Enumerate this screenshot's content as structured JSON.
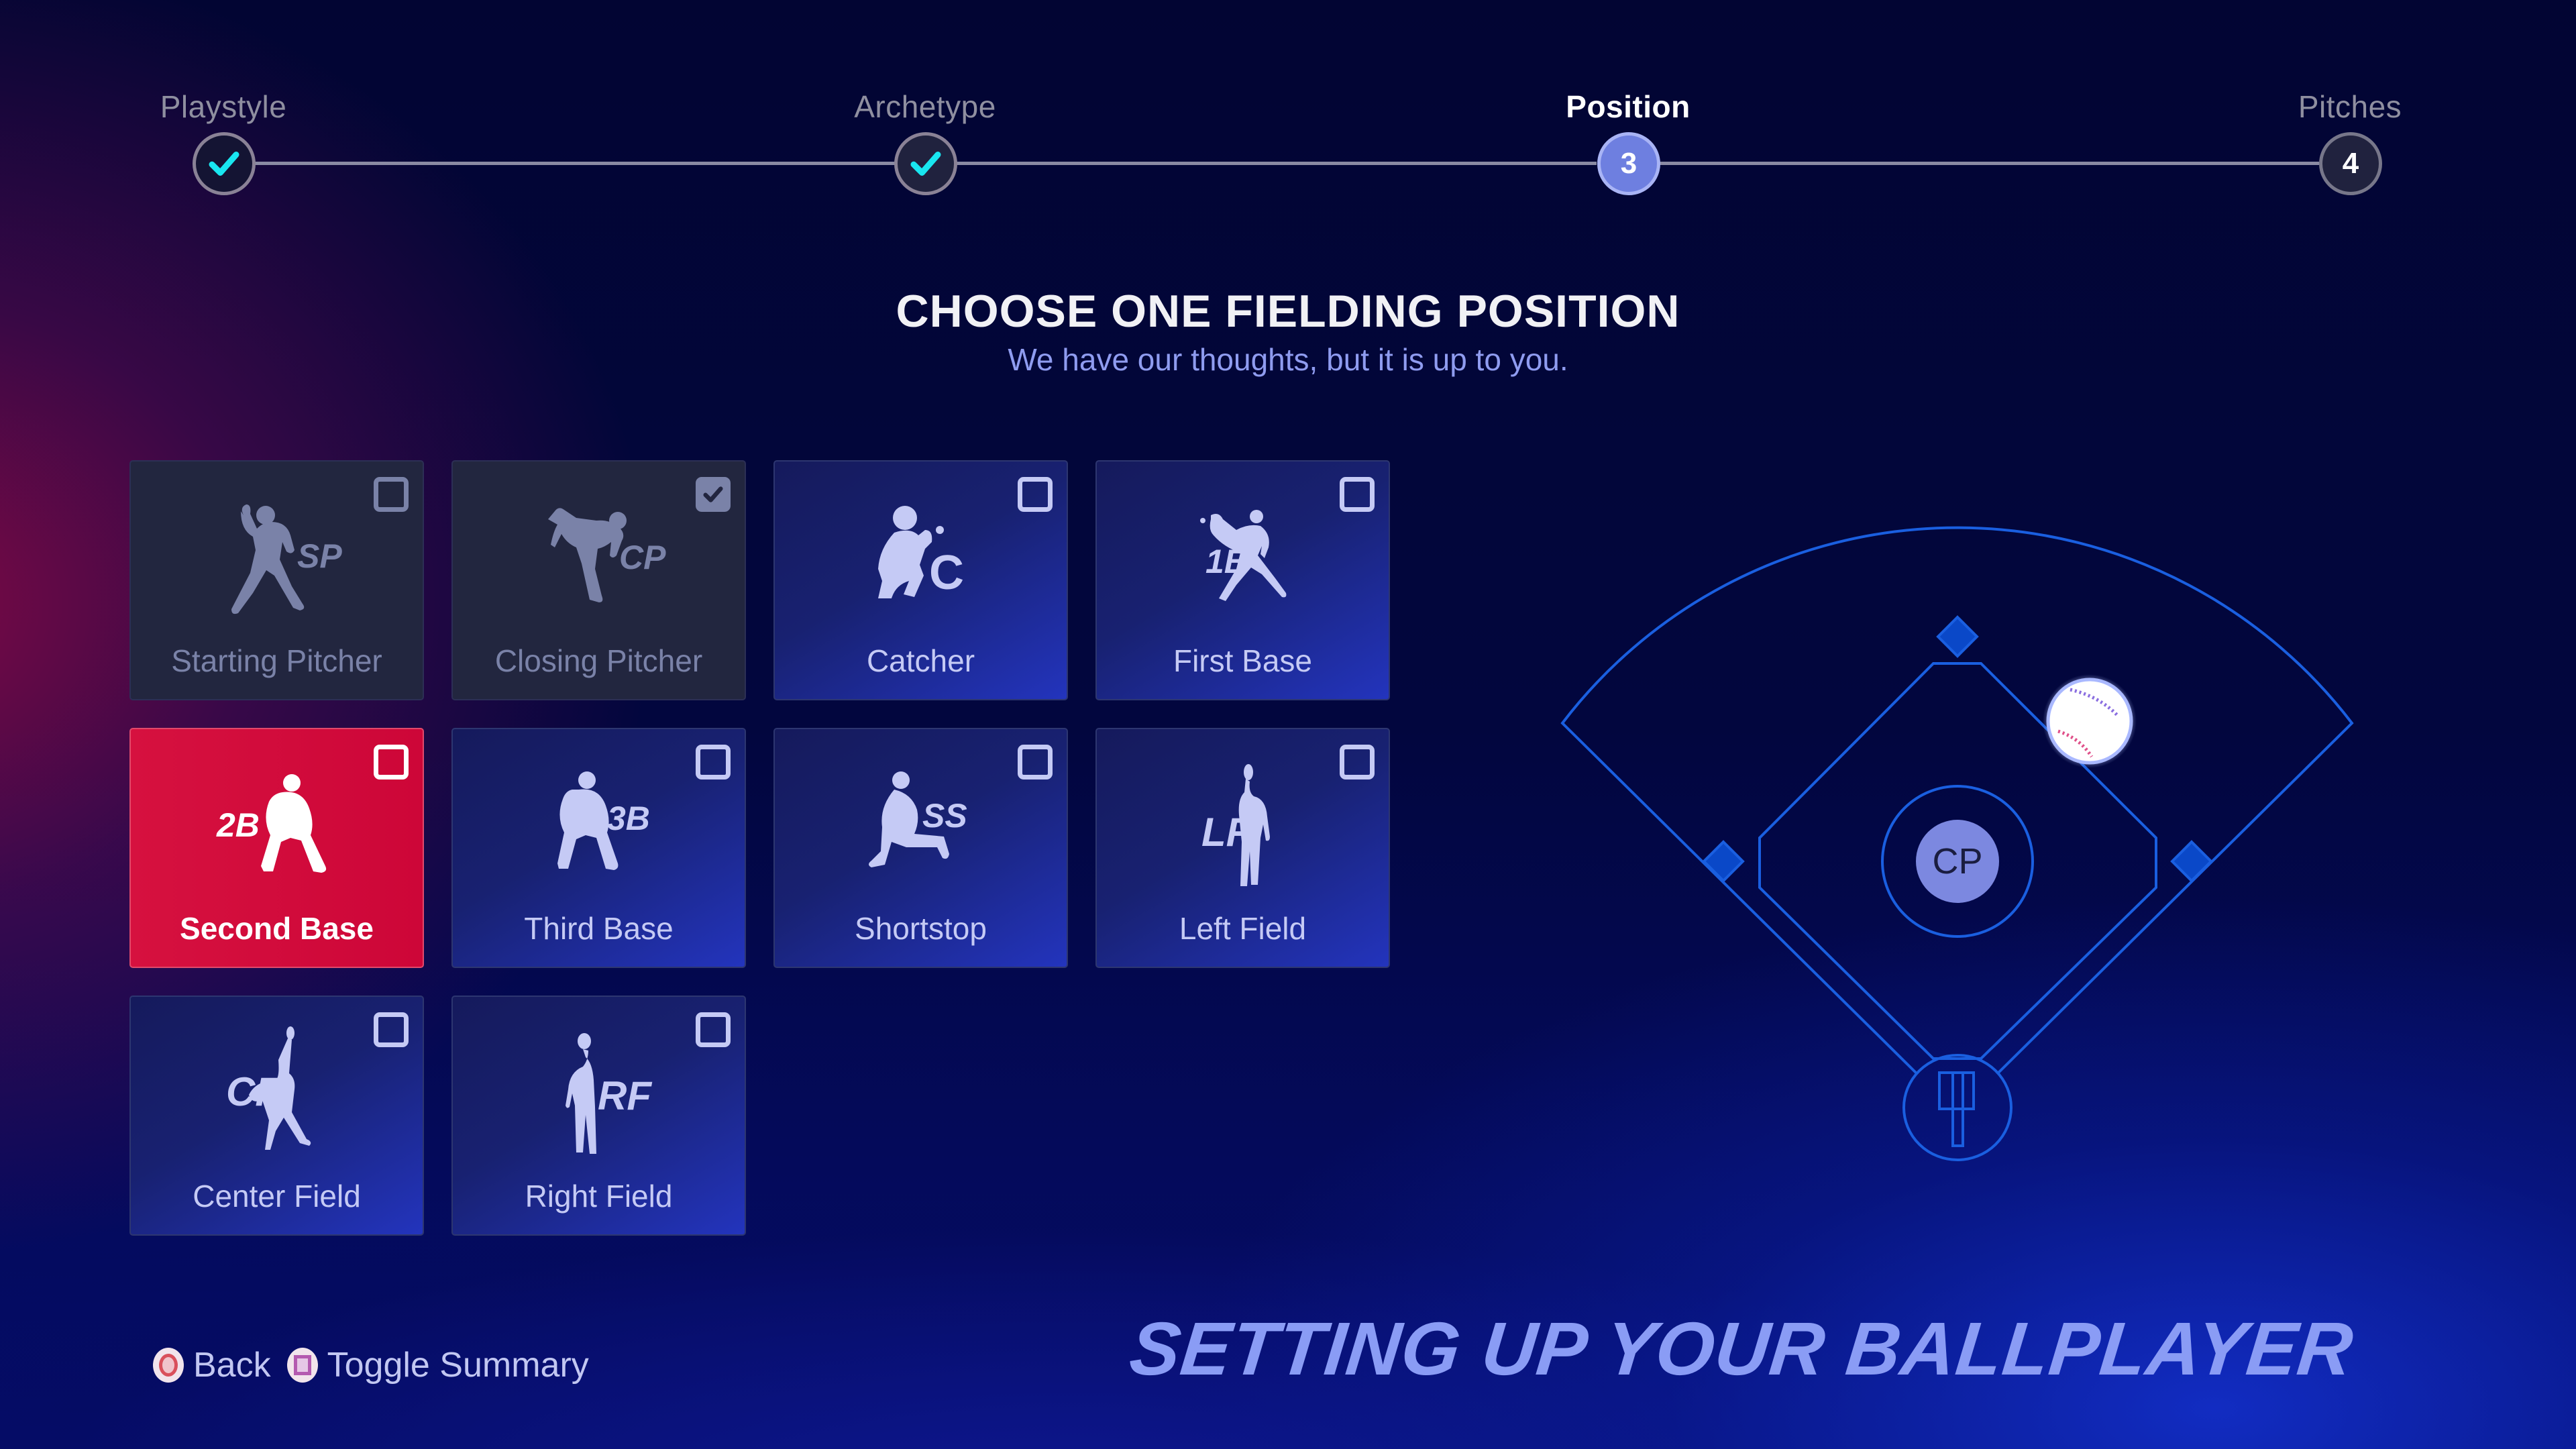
{
  "stepper": {
    "steps": [
      {
        "label": "Playstyle",
        "state": "completed",
        "icon": "checkmark-icon"
      },
      {
        "label": "Archetype",
        "state": "completed",
        "icon": "checkmark-icon"
      },
      {
        "label": "Position",
        "state": "active",
        "number": "3"
      },
      {
        "label": "Pitches",
        "state": "upcoming",
        "number": "4"
      }
    ]
  },
  "heading": {
    "title": "CHOOSE ONE FIELDING POSITION",
    "subtitle": "We have our thoughts, but it is up to you."
  },
  "positions": [
    {
      "label": "Starting Pitcher",
      "abbr": "SP",
      "state": "disabled",
      "checked": false,
      "icon": "starting-pitcher-silhouette-icon"
    },
    {
      "label": "Closing Pitcher",
      "abbr": "CP",
      "state": "disabled",
      "checked": true,
      "icon": "closing-pitcher-silhouette-icon"
    },
    {
      "label": "Catcher",
      "abbr": "C",
      "state": "available",
      "checked": false,
      "icon": "catcher-silhouette-icon"
    },
    {
      "label": "First Base",
      "abbr": "1B",
      "state": "available",
      "checked": false,
      "icon": "first-base-silhouette-icon"
    },
    {
      "label": "Second Base",
      "abbr": "2B",
      "state": "focused",
      "checked": false,
      "icon": "second-base-silhouette-icon"
    },
    {
      "label": "Third Base",
      "abbr": "3B",
      "state": "available",
      "checked": false,
      "icon": "third-base-silhouette-icon"
    },
    {
      "label": "Shortstop",
      "abbr": "SS",
      "state": "available",
      "checked": false,
      "icon": "shortstop-silhouette-icon"
    },
    {
      "label": "Left Field",
      "abbr": "LF",
      "state": "available",
      "checked": false,
      "icon": "left-field-silhouette-icon"
    },
    {
      "label": "Center Field",
      "abbr": "CF",
      "state": "available",
      "checked": false,
      "icon": "center-field-silhouette-icon"
    },
    {
      "label": "Right Field",
      "abbr": "RF",
      "state": "available",
      "checked": false,
      "icon": "right-field-silhouette-icon"
    }
  ],
  "field_diagram": {
    "current_position_marker": "CP",
    "ball_icon": "baseball-icon",
    "colors": {
      "lines": "#1a5fe0",
      "marker": "#7c88e0"
    }
  },
  "footer": {
    "hints": [
      {
        "button": "circle",
        "label": "Back"
      },
      {
        "button": "square",
        "label": "Toggle Summary"
      }
    ],
    "title": "SETTING UP YOUR BALLPLAYER"
  },
  "colors": {
    "accent_selected": "#d20f3f",
    "tile_available": "#1c2690",
    "tile_disabled": "#22263f",
    "step_check": "#19e6f0",
    "step_active": "#6e7fe0",
    "title_accent": "#8a9cf5"
  }
}
